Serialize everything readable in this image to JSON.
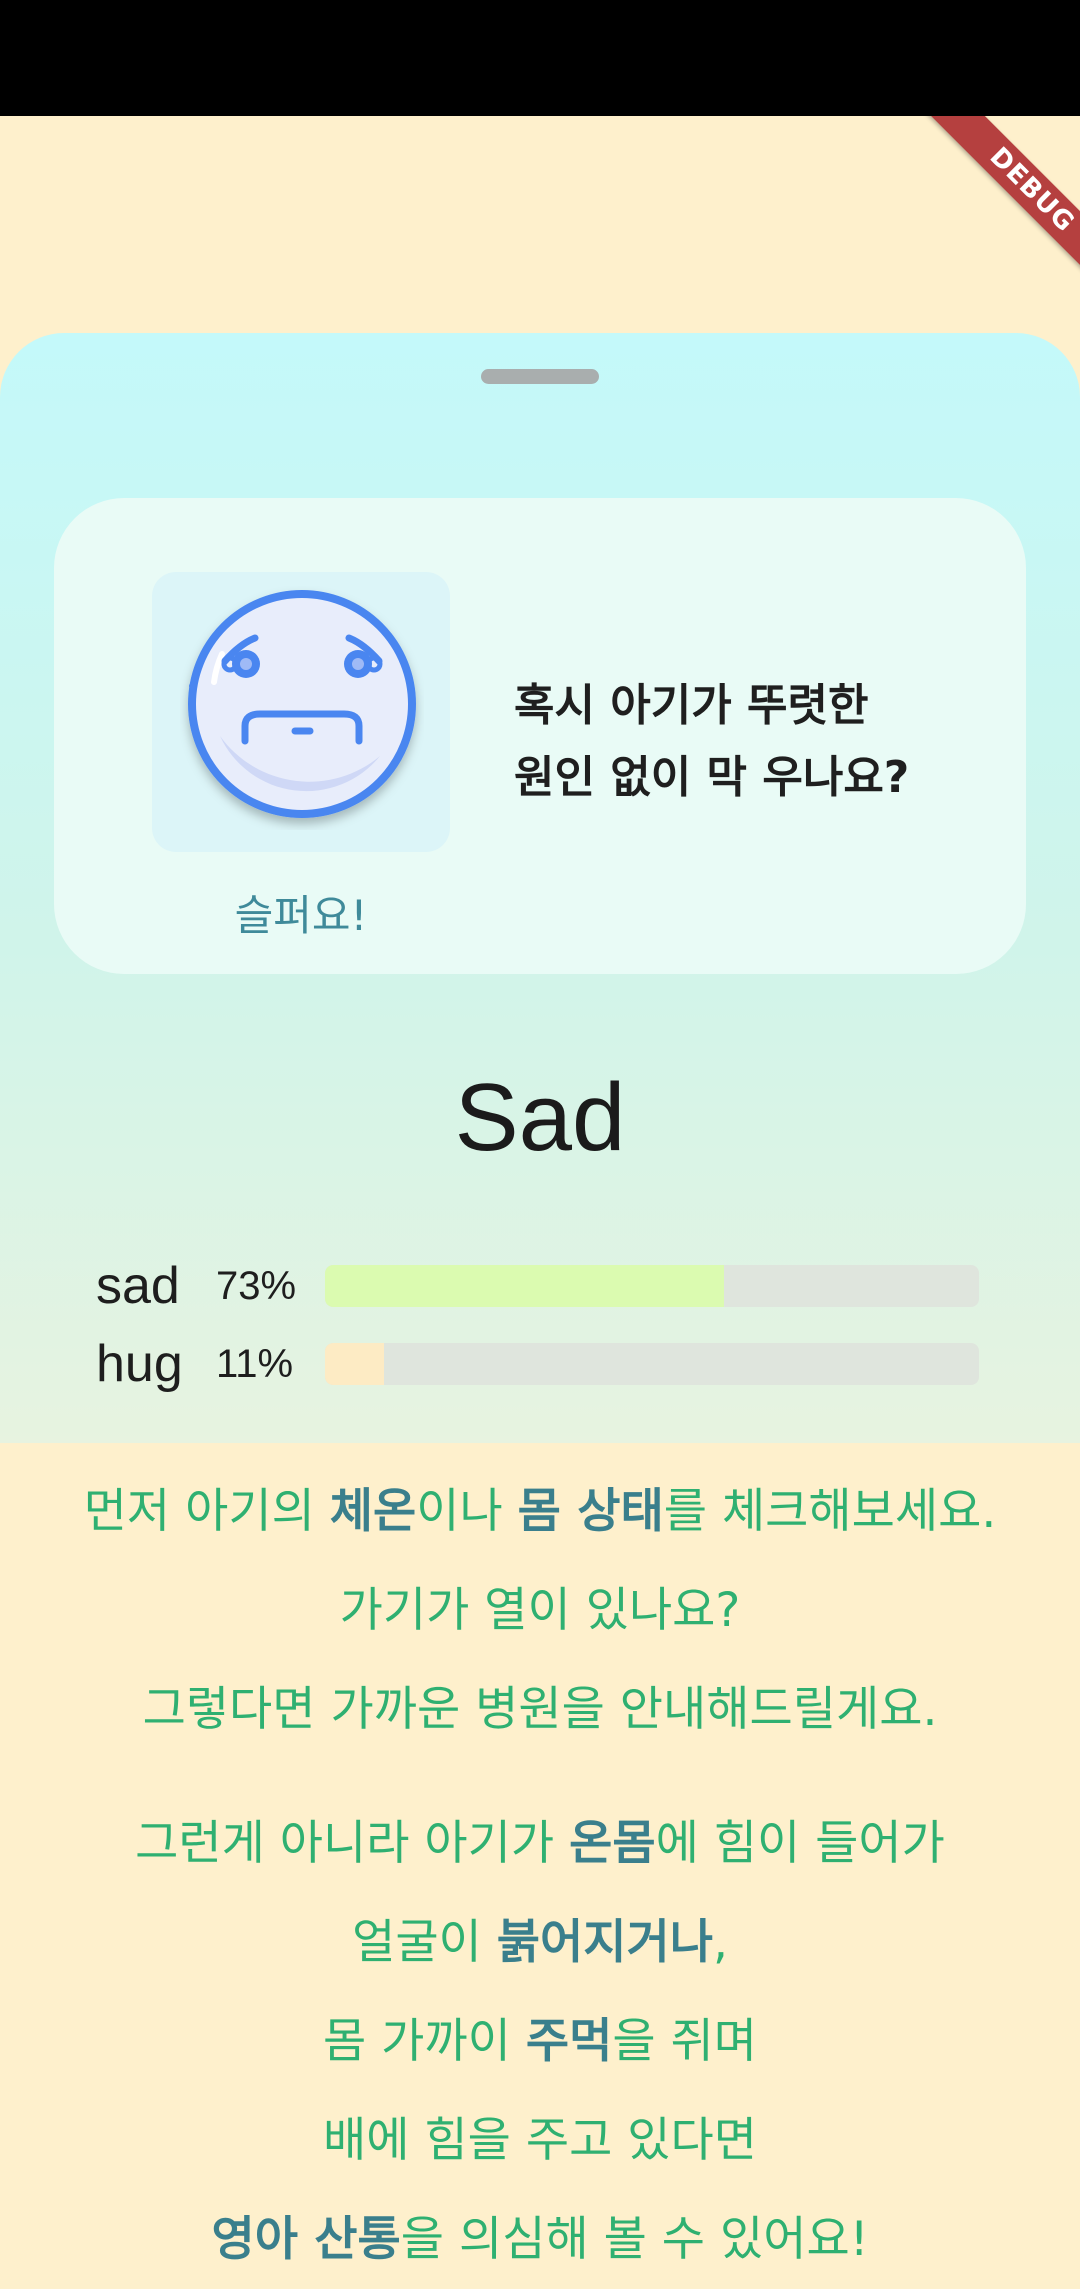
{
  "debug_banner": "DEBUG",
  "card": {
    "emoji_icon": "sad-face-icon",
    "emoji_label": "슬퍼요!",
    "question_line1": "혹시 아기가 뚜렷한",
    "question_line2": "원인 없이 막 우나요?"
  },
  "emotion_title": "Sad",
  "emotion_bars": [
    {
      "label": "sad",
      "percent_text": "73%",
      "value": 0.61,
      "color": "#dbfbb0"
    },
    {
      "label": "hug",
      "percent_text": "11%",
      "value": 0.09,
      "color": "#fdebc4"
    }
  ],
  "guide": {
    "paragraph1": [
      {
        "a": "먼저 아기의 ",
        "b": "체온",
        "c": "이나 ",
        "d": "몸 상태",
        "e": "를 체크해보세요."
      },
      {
        "a": "가기가 열이 있나요?",
        "b": "",
        "c": "",
        "d": "",
        "e": ""
      },
      {
        "a": "그렇다면 가까운 병원을 안내해드릴게요.",
        "b": "",
        "c": "",
        "d": "",
        "e": ""
      }
    ],
    "paragraph2": [
      {
        "a": "그런게 아니라 아기가 ",
        "b": "온몸",
        "c": "에 힘이 들어가"
      },
      {
        "a": "얼굴이 ",
        "b": "붉어지거나",
        "c": ","
      },
      {
        "a": "몸 가까이 ",
        "b": "주먹",
        "c": "을 쥐며"
      },
      {
        "a": "배에 힘을 주고 있다면",
        "b": "",
        "c": ""
      },
      {
        "a": "",
        "b": "영아 산통",
        "c": "을 의심해 볼 수 있어요!"
      }
    ]
  },
  "colors": {
    "background": "#fef0cc",
    "sheet_top": "#c4f9fa",
    "accent_green": "#2fb071",
    "accent_teal": "#3a7f8c",
    "emoji_blue": "#4a86f0"
  }
}
